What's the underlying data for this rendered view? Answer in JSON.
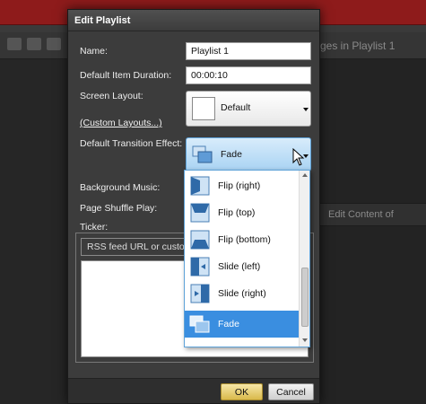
{
  "background": {
    "title_right": "ges in Playlist 1",
    "right_header": "Edit Content of"
  },
  "dialog": {
    "title": "Edit Playlist",
    "name_label": "Name:",
    "name_value": "Playlist 1",
    "duration_label": "Default Item Duration:",
    "duration_value": "00:00:10",
    "layout_label": "Screen Layout:",
    "custom_layouts_link": "(Custom Layouts...)",
    "layout_value": "Default",
    "transition_label": "Default Transition Effect:",
    "transition_value": "Fade",
    "music_label": "Background Music:",
    "shuffle_label": "Page Shuffle Play:",
    "ticker_label": "Ticker:",
    "ticker_placeholder": "RSS feed URL or custom te",
    "ok_label": "OK",
    "cancel_label": "Cancel"
  },
  "transition_dropdown": {
    "items": [
      {
        "label": "Flip (right)",
        "icon": "flip-right-icon"
      },
      {
        "label": "Flip (top)",
        "icon": "flip-top-icon"
      },
      {
        "label": "Flip (bottom)",
        "icon": "flip-bottom-icon"
      },
      {
        "label": "Slide (left)",
        "icon": "slide-left-icon"
      },
      {
        "label": "Slide (right)",
        "icon": "slide-right-icon"
      },
      {
        "label": "Fade",
        "icon": "fade-icon",
        "selected": true
      }
    ]
  },
  "colors": {
    "selected_item": "#3a8ee0",
    "combo_highlight": "#a9d3f3",
    "ok_button": "#d9b94b",
    "app_topbar": "#8e1b1b"
  }
}
